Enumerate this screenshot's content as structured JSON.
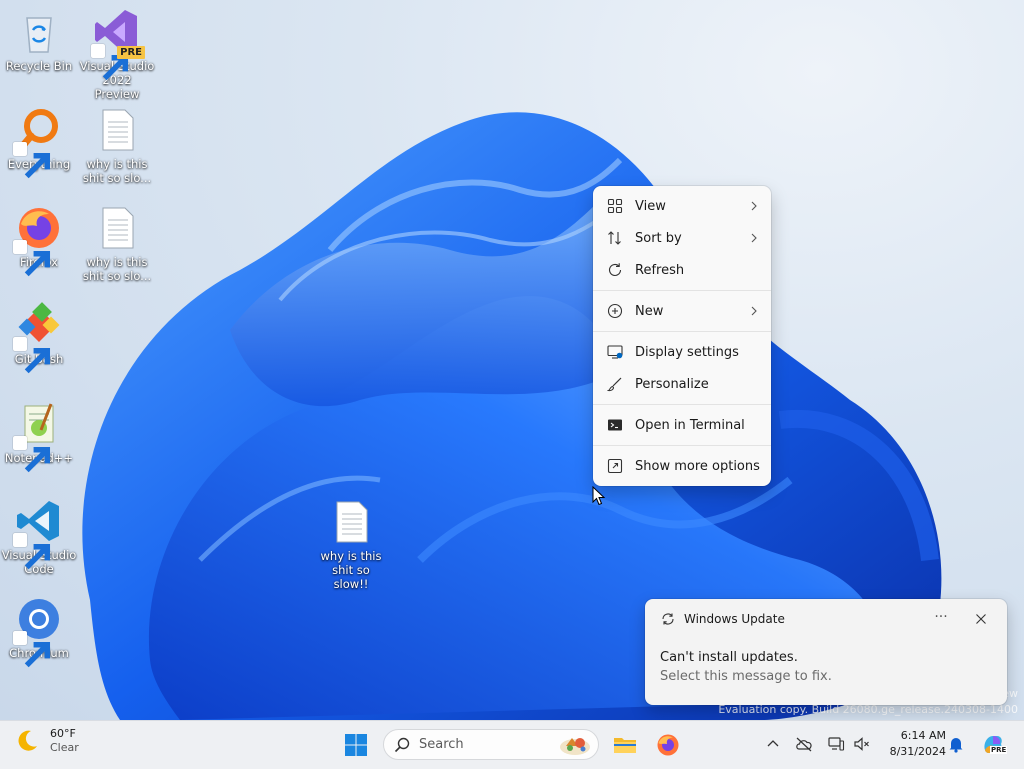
{
  "desktop": {
    "icons": [
      {
        "id": "recycle-bin",
        "label": "Recycle Bin",
        "icon": "recycle-bin-icon"
      },
      {
        "id": "visual-studio",
        "label": "Visual Studio 2022 Preview",
        "badge": "PRE",
        "icon": "visual-studio-icon"
      },
      {
        "id": "everything",
        "label": "Everything",
        "icon": "everything-icon"
      },
      {
        "id": "text-file-1",
        "label": "why is this shit so slo...",
        "icon": "text-file-icon"
      },
      {
        "id": "firefox",
        "label": "Firefox",
        "icon": "firefox-icon"
      },
      {
        "id": "text-file-2",
        "label": "why is this shit so slo...",
        "icon": "text-file-icon"
      },
      {
        "id": "git-bash",
        "label": "Git Bash",
        "icon": "git-bash-icon"
      },
      {
        "id": "notepadpp",
        "label": "Notepad++",
        "icon": "notepadpp-icon"
      },
      {
        "id": "vscode",
        "label": "Visual Studio Code",
        "icon": "vscode-icon"
      },
      {
        "id": "chromium",
        "label": "Chromium",
        "icon": "chromium-icon"
      },
      {
        "id": "text-file-3",
        "label": "why is this shit so slow!!",
        "icon": "text-file-icon"
      }
    ]
  },
  "context_menu": {
    "items": [
      {
        "label": "View",
        "icon": "grid-view-icon",
        "submenu": true
      },
      {
        "label": "Sort by",
        "icon": "sort-icon",
        "submenu": true
      },
      {
        "label": "Refresh",
        "icon": "refresh-icon",
        "submenu": false
      },
      {
        "label": "New",
        "icon": "new-plus-icon",
        "submenu": true
      },
      {
        "label": "Display settings",
        "icon": "display-icon",
        "submenu": false
      },
      {
        "label": "Personalize",
        "icon": "brush-icon",
        "submenu": false
      },
      {
        "label": "Open in Terminal",
        "icon": "terminal-icon",
        "submenu": false
      },
      {
        "label": "Show more options",
        "icon": "more-options-icon",
        "submenu": false
      }
    ]
  },
  "notification": {
    "app": "Windows Update",
    "title": "Can't install updates.",
    "body": "Select this message to fix.",
    "more": "···"
  },
  "watermark": {
    "line1": "ew",
    "line2": "Evaluation copy. Build 26080.ge_release.240308-1400"
  },
  "taskbar": {
    "weather": {
      "temp": "60°F",
      "condition": "Clear"
    },
    "search_placeholder": "Search",
    "clock": {
      "time": "6:14 AM",
      "date": "8/31/2024"
    }
  },
  "colors": {
    "accent": "#0067c0",
    "wallpaper_blue": "#1a5fe0",
    "menu_bg": "#f9f9f9",
    "taskbar_bg": "#eef0f3"
  }
}
